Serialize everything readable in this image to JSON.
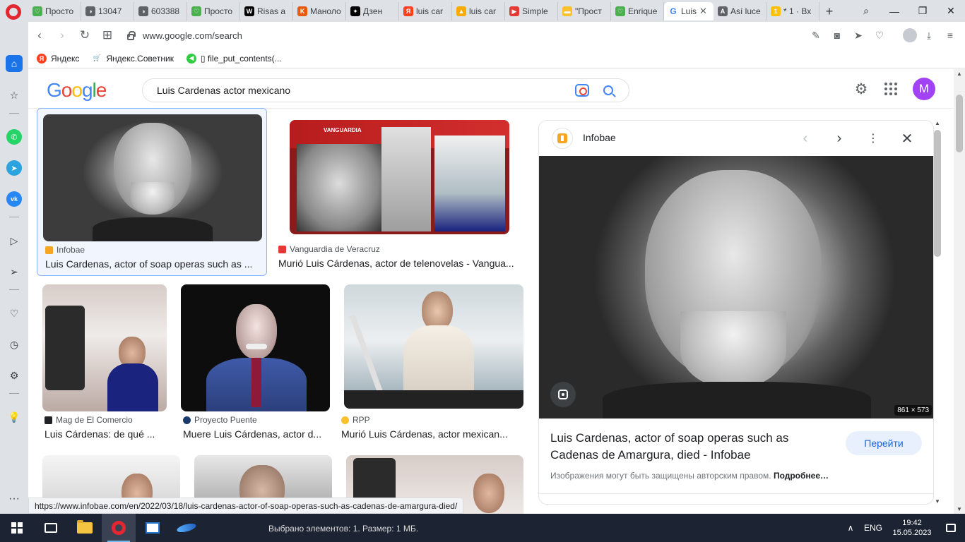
{
  "browser": {
    "tabs": [
      {
        "label": "Просто",
        "color": "#4caf50",
        "glyph": "♡"
      },
      {
        "label": "13047",
        "color": "#5f6368",
        "glyph": "◑"
      },
      {
        "label": "603388",
        "color": "#5f6368",
        "glyph": "◑"
      },
      {
        "label": "Просто",
        "color": "#4caf50",
        "glyph": "♡"
      },
      {
        "label": "Risas a",
        "color": "#000000",
        "glyph": "W"
      },
      {
        "label": "Маноло",
        "color": "#e8590c",
        "glyph": "K"
      },
      {
        "label": "Дзен",
        "color": "#000000",
        "glyph": "✦"
      },
      {
        "label": "luis car",
        "color": "#fc3f1d",
        "glyph": "Я"
      },
      {
        "label": "luis car",
        "color": "#f9ab00",
        "glyph": "▲"
      },
      {
        "label": "Simple",
        "color": "#e53935",
        "glyph": "▶"
      },
      {
        "label": "\"Прост",
        "color": "#fbc02d",
        "glyph": "▬"
      },
      {
        "label": "Enrique",
        "color": "#4caf50",
        "glyph": "♡"
      }
    ],
    "active_tab": {
      "label": "Luis",
      "glyph": "G"
    },
    "more_tabs": [
      {
        "label": "Así luce",
        "color": "#5f6368",
        "glyph": "A"
      },
      {
        "label": "* 1 · Вх",
        "color": "#ffc107",
        "glyph": "1"
      }
    ],
    "new_tab": "+",
    "url": "www.google.com/search",
    "bookmarks": [
      {
        "label": "Яндекс",
        "color": "#fc3f1d",
        "glyph": "Я"
      },
      {
        "label": "Яндекс.Советник",
        "color": "#3c4043",
        "glyph": "🛒"
      },
      {
        "label": "▯ file_put_contents(...",
        "color": "#2ecc40",
        "glyph": "◀"
      }
    ],
    "status_url": "https://www.infobae.com/en/2022/03/18/luis-cardenas-actor-of-soap-operas-such-as-cadenas-de-amargura-died/"
  },
  "google": {
    "search_value": "Luis Cardenas actor mexicano",
    "avatar_letter": "M"
  },
  "results": [
    {
      "source": "Infobae",
      "source_color": "#f6a623",
      "title": "Luis Cardenas, actor of soap operas such as ..."
    },
    {
      "source": "Vanguardia de Veracruz",
      "source_color": "#e53935",
      "title": "Murió Luis Cárdenas, actor de telenovelas - Vangua..."
    },
    {
      "source": "Mag de El Comercio",
      "source_color": "#202124",
      "title": "Luis Cárdenas: de qué ..."
    },
    {
      "source": "Proyecto Puente",
      "source_color": "#1a3a6b",
      "title": "Muere Luis Cárdenas, actor d..."
    },
    {
      "source": "RPP",
      "source_color": "#fbc02d",
      "title": "Murió Luis Cárdenas, actor mexican..."
    }
  ],
  "panel": {
    "site": "Infobae",
    "title": "Luis Cardenas, actor of soap operas such as Cadenas de Amargura, died - Infobae",
    "go_button": "Перейти",
    "dimensions": "861 × 573",
    "copyright_note": "Изображения могут быть защищены авторским правом.",
    "more_link": "Подробнее…",
    "banner_text": "VANGUARDIA"
  },
  "taskbar": {
    "status": "Выбрано элементов: 1. Размер: 1 МБ.",
    "lang": "ENG",
    "time": "19:42",
    "date": "15.05.2023"
  }
}
